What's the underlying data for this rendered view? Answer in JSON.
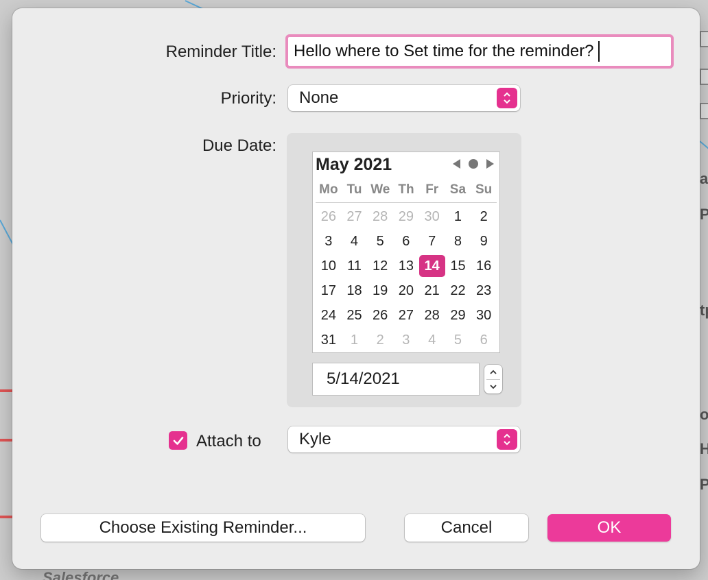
{
  "dialog": {
    "title_label": "Reminder Title:",
    "title_value": "Hello where to Set time for the reminder?",
    "priority_label": "Priority:",
    "priority_value": "None",
    "due_date_label": "Due Date:",
    "attach_label": "Attach to",
    "attach_checked": true,
    "attach_value": "Kyle"
  },
  "calendar": {
    "month_label": "May 2021",
    "weekdays": [
      "Mo",
      "Tu",
      "We",
      "Th",
      "Fr",
      "Sa",
      "Su"
    ],
    "weeks": [
      [
        "26",
        "27",
        "28",
        "29",
        "30",
        "1",
        "2"
      ],
      [
        "3",
        "4",
        "5",
        "6",
        "7",
        "8",
        "9"
      ],
      [
        "10",
        "11",
        "12",
        "13",
        "14",
        "15",
        "16"
      ],
      [
        "17",
        "18",
        "19",
        "20",
        "21",
        "22",
        "23"
      ],
      [
        "24",
        "25",
        "26",
        "27",
        "28",
        "29",
        "30"
      ],
      [
        "31",
        "1",
        "2",
        "3",
        "4",
        "5",
        "6"
      ]
    ],
    "selected_day": "14",
    "date_text": "5/14/2021"
  },
  "buttons": {
    "choose_existing": "Choose Existing Reminder...",
    "cancel": "Cancel",
    "ok": "OK"
  },
  "colors": {
    "accent": "#e5318f",
    "selected_day": "#d63384",
    "focus_ring": "#e98bbd"
  },
  "background": {
    "fragment_bottom": "Salesforce",
    "fragments_right": [
      "ac",
      "P",
      "tp",
      "oc",
      "HI",
      "PI"
    ]
  }
}
